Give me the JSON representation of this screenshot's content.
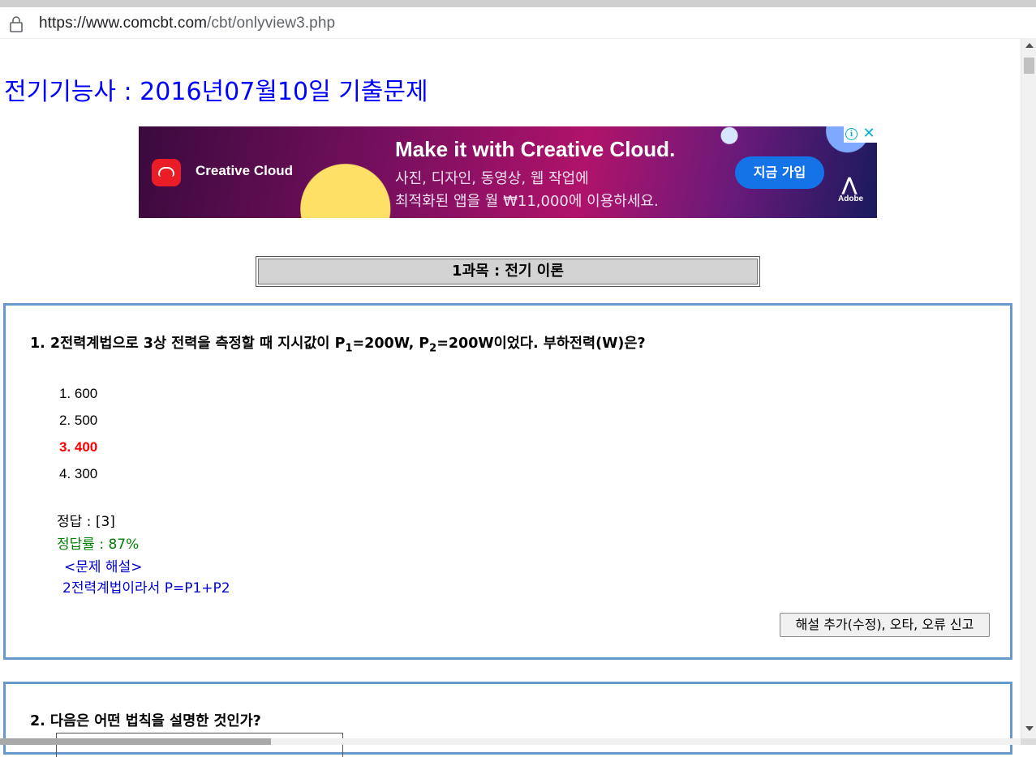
{
  "browser": {
    "url_host": "https://www.comcbt.com",
    "url_path": "/cbt/onlyview3.php"
  },
  "page": {
    "title": "전기기능사 : 2016년07월10일 기출문제"
  },
  "ad": {
    "brand": "Creative Cloud",
    "headline": "Make it with Creative Cloud.",
    "line1": "사진, 디자인, 동영상, 웹 작업에",
    "line2": "최적화된 앱을 월 ₩11,000에 이용하세요.",
    "cta": "지금 가입",
    "adobe_label": "Adobe",
    "info_glyph": "i",
    "close_glyph": "✕"
  },
  "subject": {
    "label": "1과목 : 전기 이론"
  },
  "questions": [
    {
      "title_a": "1. 2전력계법으로 3상 전력을 측정할 때 지시값이 P",
      "sub1": "1",
      "title_b": "=200W, P",
      "sub2": "2",
      "title_c": "=200W이었다. 부하전력(W)은?",
      "options": [
        "1. 600",
        "2. 500",
        "3. 400",
        "4. 300"
      ],
      "correct_index": 2,
      "answer": "정답 : [3]",
      "rate": "정답률 : 87%",
      "explanation_header": "<문제 해설>",
      "explanation": "2전력계법이라서  P=P1+P2",
      "report_button": "해설 추가(수정), 오타, 오류 신고"
    },
    {
      "title": "2. 다음은 어떤 법칙을 설명한 것인가?"
    }
  ]
}
